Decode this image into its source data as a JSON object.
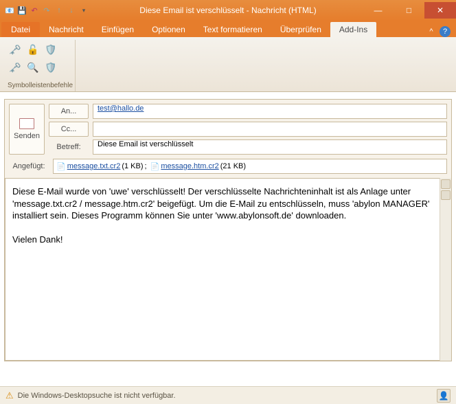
{
  "titlebar": {
    "title": "Diese Email ist verschlüsselt - Nachricht (HTML)"
  },
  "tabs": {
    "file": "Datei",
    "items": [
      "Nachricht",
      "Einfügen",
      "Optionen",
      "Text formatieren",
      "Überprüfen",
      "Add-Ins"
    ],
    "active": "Add-Ins"
  },
  "ribbon": {
    "group_label": "Symbolleistenbefehle"
  },
  "compose": {
    "send": "Senden",
    "to_btn": "An...",
    "to_value": "test@hallo.de",
    "cc_btn": "Cc...",
    "cc_value": "",
    "subject_label": "Betreff:",
    "subject_value": "Diese Email ist verschlüsselt",
    "attached_label": "Angefügt:",
    "attachments": [
      {
        "name": "message.txt.cr2",
        "size": "(1 KB)"
      },
      {
        "name": "message.htm.cr2",
        "size": "(21 KB)"
      }
    ]
  },
  "body": {
    "p1": "Diese E-Mail wurde von 'uwe' verschlüsselt! Der verschlüsselte Nachrichteninhalt ist als Anlage unter 'message.txt.cr2 / message.htm.cr2' beigefügt.  Um die E-Mail zu entschlüsseln, muss 'abylon MANAGER' installiert sein. Dieses Programm können Sie unter 'www.abylonsoft.de' downloaden.",
    "p2": "Vielen Dank!"
  },
  "status": {
    "text": "Die Windows-Desktopsuche ist nicht verfügbar."
  }
}
